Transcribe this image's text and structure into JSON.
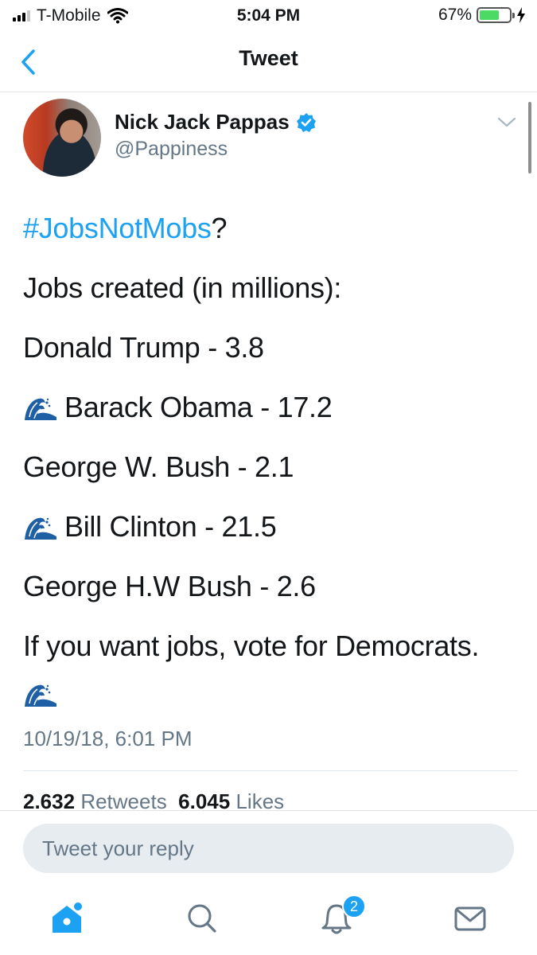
{
  "status_bar": {
    "carrier": "T-Mobile",
    "time": "5:04 PM",
    "battery": "67%",
    "battery_level": 0.67
  },
  "nav": {
    "title": "Tweet"
  },
  "tweet": {
    "author_name": "Nick Jack Pappas",
    "author_handle": "@Pappiness",
    "hashtag": "#JobsNotMobs",
    "hashtag_suffix": "?",
    "lines": [
      "Jobs created (in millions):",
      "Donald Trump - 3.8",
      "Barack Obama - 17.2",
      "George W. Bush - 2.1",
      "Bill Clinton - 21.5",
      "George H.W Bush - 2.6",
      "If you want jobs, vote for Democrats."
    ],
    "timestamp": "10/19/18, 6:01 PM",
    "retweet_count": "2.632",
    "retweet_label": "Retweets",
    "like_count": "6.045",
    "like_label": "Likes"
  },
  "reply": {
    "placeholder": "Tweet your reply"
  },
  "tab_bar": {
    "notification_badge": "2",
    "active_tab": "home",
    "icons": [
      "home-icon",
      "search-icon",
      "notifications-icon",
      "messages-icon"
    ]
  },
  "colors": {
    "accent": "#1da1f2",
    "text": "#14171a",
    "secondary": "#657786"
  }
}
